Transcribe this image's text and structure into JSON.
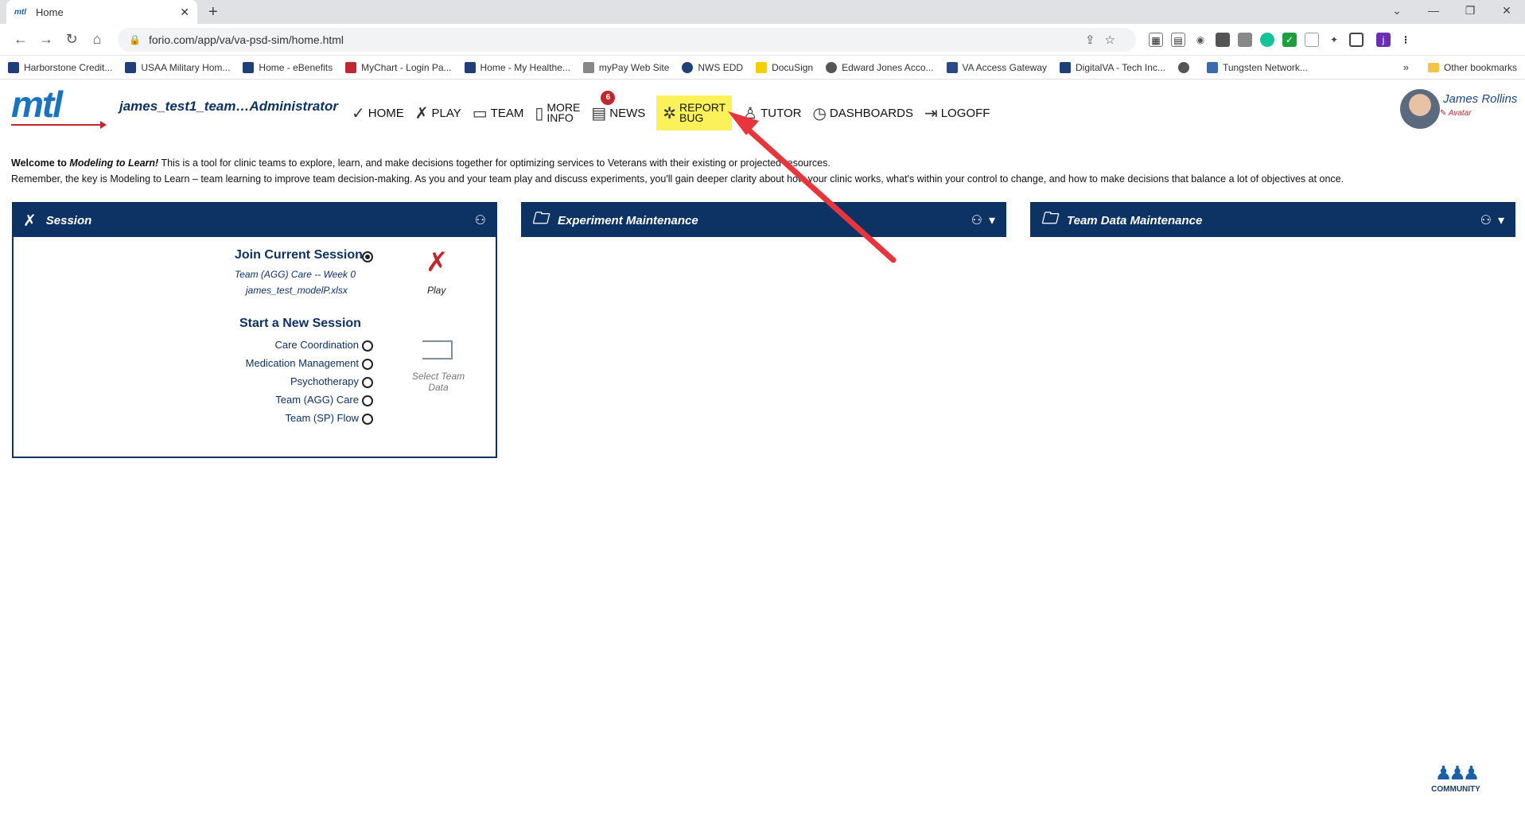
{
  "browser": {
    "tab_title": "Home",
    "tab_favicon": "mtl",
    "url": "forio.com/app/va/va-psd-sim/home.html",
    "profile_initial": "j",
    "bookmarks": [
      "Harborstone Credit...",
      "USAA Military Hom...",
      "Home - eBenefits",
      "MyChart - Login Pa...",
      "Home - My Healthe...",
      "myPay Web Site",
      "NWS EDD",
      "DocuSign",
      "Edward Jones Acco...",
      "VA Access Gateway",
      "DigitalVA - Tech Inc...",
      "Tungsten Network..."
    ],
    "other_bookmarks": "Other bookmarks"
  },
  "app": {
    "logo_text": "mtl",
    "team_name": "james_test1_team…Administrator",
    "nav": {
      "home": "HOME",
      "play": "PLAY",
      "team": "TEAM",
      "more_info_1": "MORE",
      "more_info_2": "INFO",
      "news": "NEWS",
      "news_badge": "6",
      "report_bug_1": "REPORT",
      "report_bug_2": "BUG",
      "tutor": "TUTOR",
      "dashboards": "DASHBOARDS",
      "logoff": "LOGOFF"
    },
    "user": {
      "name": "James Rollins",
      "avatar_link": "Avatar"
    }
  },
  "welcome": {
    "line1_prefix": "Welcome to ",
    "line1_em": "Modeling to Learn!",
    "line1_rest": " This is a tool for clinic teams to explore, learn, and make decisions together for optimizing services to Veterans with their existing or projected resources.",
    "line2": "Remember, the key is Modeling to Learn – team learning to improve team decision-making. As you and your team play and discuss experiments, you'll gain deeper clarity about how your clinic works, what's within your control to change, and how to make decisions that balance a lot of objectives at once."
  },
  "panels": {
    "session": {
      "title": "Session",
      "join_title": "Join Current Session",
      "join_team": "Team (AGG) Care -- Week 0",
      "join_file": "james_test_modelP.xlsx",
      "play_label": "Play",
      "new_title": "Start a New Session",
      "options": [
        "Care Coordination",
        "Medication Management",
        "Psychotherapy",
        "Team (AGG) Care",
        "Team (SP) Flow"
      ],
      "select_label": "Select Team Data"
    },
    "experiment": {
      "title": "Experiment Maintenance"
    },
    "teamdata": {
      "title": "Team Data Maintenance"
    }
  },
  "community": {
    "label": "COMMUNITY"
  },
  "colors": {
    "navy": "#0d3264",
    "logo_blue": "#1a73c1",
    "accent_red": "#c0282d",
    "highlight_yellow": "#fbf25a",
    "annotation_arrow": "#e8353b"
  }
}
